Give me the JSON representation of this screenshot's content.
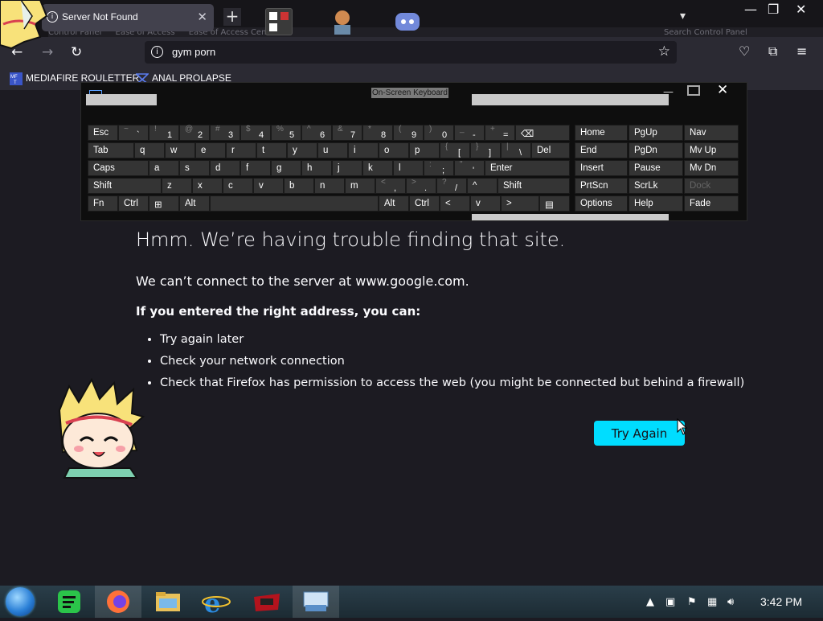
{
  "browser": {
    "tab_title": "Server Not Found",
    "url": "gym porn",
    "ghost_address_parts": [
      "Control Panel",
      "Ease of Access",
      "Ease of Access Center"
    ],
    "ghost_search_placeholder": "Search Control Panel"
  },
  "bookmarks": [
    {
      "label": "MEDIAFIRE ROULETTER",
      "icon": "mediafire-icon"
    },
    {
      "label": "ANAL PROLAPSE",
      "icon": "bookmark-logo-icon"
    }
  ],
  "error_page": {
    "title": "Hmm. We’re having trouble finding that site.",
    "description": "We can’t connect to the server at www.google.com.",
    "subtitle": "If you entered the right address, you can:",
    "suggestions": [
      "Try again later",
      "Check your network connection",
      "Check that Firefox has permission to access the web (you might be connected but behind a firewall)"
    ],
    "try_again_label": "Try Again",
    "accent_color": "#00ddff"
  },
  "osk": {
    "title": "On-Screen Keyboard",
    "row1": [
      {
        "label": "Esc"
      },
      {
        "top": "~",
        "bot": "`"
      },
      {
        "top": "!",
        "bot": "1"
      },
      {
        "top": "@",
        "bot": "2"
      },
      {
        "top": "#",
        "bot": "3"
      },
      {
        "top": "$",
        "bot": "4"
      },
      {
        "top": "%",
        "bot": "5"
      },
      {
        "top": "^",
        "bot": "6"
      },
      {
        "top": "&",
        "bot": "7"
      },
      {
        "top": "*",
        "bot": "8"
      },
      {
        "top": "(",
        "bot": "9"
      },
      {
        "top": ")",
        "bot": "0"
      },
      {
        "top": "_",
        "bot": "-"
      },
      {
        "top": "+",
        "bot": "="
      },
      {
        "label": "⌫"
      }
    ],
    "row2": [
      {
        "label": "Tab"
      },
      {
        "label": "q"
      },
      {
        "label": "w"
      },
      {
        "label": "e"
      },
      {
        "label": "r"
      },
      {
        "label": "t"
      },
      {
        "label": "y"
      },
      {
        "label": "u"
      },
      {
        "label": "i"
      },
      {
        "label": "o"
      },
      {
        "label": "p"
      },
      {
        "top": "{",
        "bot": "["
      },
      {
        "top": "}",
        "bot": "]"
      },
      {
        "top": "|",
        "bot": "\\"
      },
      {
        "label": "Del"
      }
    ],
    "row3": [
      {
        "label": "Caps"
      },
      {
        "label": "a"
      },
      {
        "label": "s"
      },
      {
        "label": "d"
      },
      {
        "label": "f"
      },
      {
        "label": "g"
      },
      {
        "label": "h"
      },
      {
        "label": "j"
      },
      {
        "label": "k"
      },
      {
        "label": "l"
      },
      {
        "top": ":",
        "bot": ";"
      },
      {
        "top": "\"",
        "bot": "'"
      },
      {
        "label": "Enter"
      }
    ],
    "row4": [
      {
        "label": "Shift"
      },
      {
        "label": "z"
      },
      {
        "label": "x"
      },
      {
        "label": "c"
      },
      {
        "label": "v"
      },
      {
        "label": "b"
      },
      {
        "label": "n"
      },
      {
        "label": "m"
      },
      {
        "top": "<",
        "bot": ","
      },
      {
        "top": ">",
        "bot": "."
      },
      {
        "top": "?",
        "bot": "/"
      },
      {
        "label": "^"
      },
      {
        "label": "Shift"
      }
    ],
    "row5": [
      {
        "label": "Fn"
      },
      {
        "label": "Ctrl"
      },
      {
        "label": "⊞"
      },
      {
        "label": "Alt"
      },
      {
        "label": ""
      },
      {
        "label": "Alt"
      },
      {
        "label": "Ctrl"
      },
      {
        "label": "<"
      },
      {
        "label": "v"
      },
      {
        "label": ">"
      },
      {
        "label": "▤"
      }
    ],
    "right_keys": [
      [
        "Home",
        "PgUp",
        "Nav"
      ],
      [
        "End",
        "PgDn",
        "Mv Up"
      ],
      [
        "Insert",
        "Pause",
        "Mv Dn"
      ],
      [
        "PrtScn",
        "ScrLk",
        "Dock"
      ],
      [
        "Options",
        "Help",
        "Fade"
      ]
    ]
  },
  "taskbar": {
    "time": "3:42 PM",
    "apps": [
      "spotify-icon",
      "firefox-icon",
      "file-explorer-icon",
      "internet-explorer-icon",
      "media-app-icon",
      "on-screen-keyboard-icon"
    ]
  }
}
